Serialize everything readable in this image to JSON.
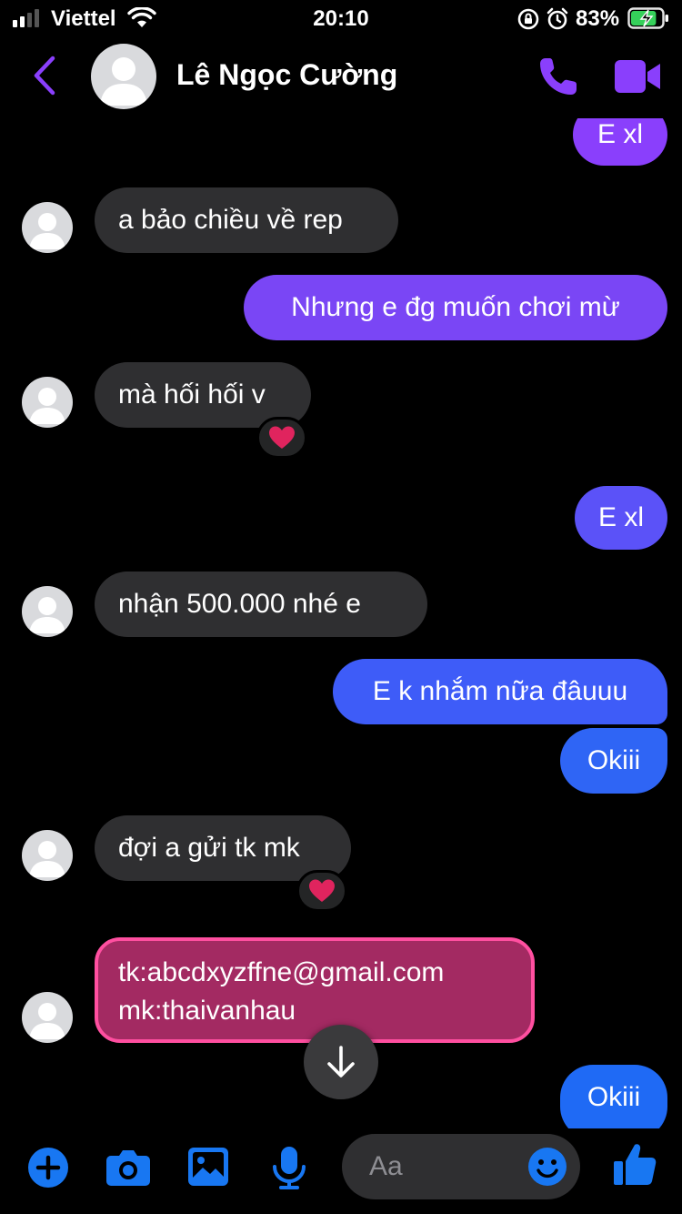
{
  "status": {
    "carrier": "Viettel",
    "time": "20:10",
    "battery": "83%",
    "battery_level": 0.83
  },
  "header": {
    "contact_name": "Lê Ngọc Cường"
  },
  "colors": {
    "accent": "#8a3ffc",
    "blue": "#1877f2",
    "incoming": "#2f2f31",
    "credential_bg": "#a32a62",
    "credential_border": "#ff4fa0",
    "reaction": "#e0245e"
  },
  "messages": [
    {
      "from": "me",
      "text": "E xl"
    },
    {
      "from": "contact",
      "text": "a bảo chiều về rep"
    },
    {
      "from": "me",
      "text": "Nhưng e đg muốn chơi mừ"
    },
    {
      "from": "contact",
      "text": "mà hối hối v",
      "reaction": "heart"
    },
    {
      "from": "me",
      "text": "E xl"
    },
    {
      "from": "contact",
      "text": "nhận 500.000 nhé e"
    },
    {
      "from": "me",
      "text": "E k nhắm nữa đâuuu"
    },
    {
      "from": "me",
      "text": "Okiii"
    },
    {
      "from": "contact",
      "text": "đợi a gửi tk mk",
      "reaction": "heart"
    },
    {
      "from": "contact",
      "lines": [
        "tk:abcdxyzffne@gmail.com",
        "mk:thaivanhau"
      ]
    },
    {
      "from": "me",
      "text": "Okiii"
    }
  ],
  "composer": {
    "placeholder": "Aa",
    "icons": [
      "plus-icon",
      "camera-icon",
      "image-icon",
      "microphone-icon",
      "emoji-icon",
      "thumbs-up-icon"
    ]
  }
}
